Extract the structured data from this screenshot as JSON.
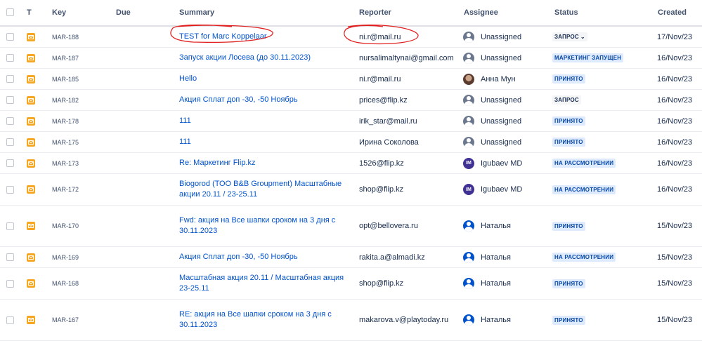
{
  "columns": {
    "t": "T",
    "key": "Key",
    "due": "Due",
    "summary": "Summary",
    "reporter": "Reporter",
    "assignee": "Assignee",
    "status": "Status",
    "created": "Created"
  },
  "colors": {
    "link": "#0052cc",
    "annotation": "#e02020",
    "type_icon": "#f5a623"
  },
  "rows": [
    {
      "key": "MAR-188",
      "summary": "TEST for Marc Koppelaar",
      "reporter": "ni.r@mail.ru",
      "assignee": "Unassigned",
      "assignee_avatar": "generic-user-avatar",
      "status": "ЗАПРОС",
      "status_style": "gray",
      "status_dropdown": true,
      "created": "17/Nov/23"
    },
    {
      "key": "MAR-187",
      "summary": "Запуск акции Лосева (до 30.11.2023)",
      "reporter": "nursalimaltynai@gmail.com",
      "assignee": "Unassigned",
      "assignee_avatar": "generic-user-avatar",
      "status": "МАРКЕТИНГ ЗАПУЩЕН",
      "status_style": "blue",
      "created": "16/Nov/23"
    },
    {
      "key": "MAR-185",
      "summary": "Hello",
      "reporter": "ni.r@mail.ru",
      "assignee": "Анна Мун",
      "assignee_avatar": "photo-avatar",
      "status": "ПРИНЯТО",
      "status_style": "blue",
      "created": "16/Nov/23"
    },
    {
      "key": "MAR-182",
      "summary": "Акция Сплат доп -30, -50 Ноябрь",
      "reporter": "prices@flip.kz",
      "assignee": "Unassigned",
      "assignee_avatar": "generic-user-avatar",
      "status": "ЗАПРОС",
      "status_style": "gray",
      "created": "16/Nov/23"
    },
    {
      "key": "MAR-178",
      "summary": "111",
      "reporter": "irik_star@mail.ru",
      "assignee": "Unassigned",
      "assignee_avatar": "generic-user-avatar",
      "status": "ПРИНЯТО",
      "status_style": "blue",
      "created": "16/Nov/23"
    },
    {
      "key": "MAR-175",
      "summary": "111",
      "reporter": "Ирина Соколова",
      "assignee": "Unassigned",
      "assignee_avatar": "generic-user-avatar",
      "status": "ПРИНЯТО",
      "status_style": "blue",
      "created": "16/Nov/23"
    },
    {
      "key": "MAR-173",
      "summary": "Re: Маркетинг Flip.kz",
      "reporter": "1526@flip.kz",
      "assignee": "Igubaev MD",
      "assignee_avatar": "initials-avatar",
      "avatar_initials": "IM",
      "status": "НА РАССМОТРЕНИИ",
      "status_style": "blue",
      "created": "16/Nov/23"
    },
    {
      "key": "MAR-172",
      "summary": "Biogorod (ТОО B&B Groupment) Масштабные акции 20.11 / 23-25.11",
      "reporter": "shop@flip.kz",
      "assignee": "Igubaev MD",
      "assignee_avatar": "initials-avatar",
      "avatar_initials": "IM",
      "status": "НА РАССМОТРЕНИИ",
      "status_style": "blue",
      "created": "16/Nov/23"
    },
    {
      "key": "MAR-170",
      "summary": "Fwd: акция на Все шапки сроком на 3 дня с 30.11.2023",
      "reporter": "opt@bellovera.ru",
      "assignee": "Наталья",
      "assignee_avatar": "user-avatar",
      "status": "ПРИНЯТО",
      "status_style": "blue",
      "created": "15/Nov/23"
    },
    {
      "key": "MAR-169",
      "summary": "Акция Сплат доп -30, -50 Ноябрь",
      "reporter": "rakita.a@almadi.kz",
      "assignee": "Наталья",
      "assignee_avatar": "user-avatar",
      "status": "НА РАССМОТРЕНИИ",
      "status_style": "blue",
      "created": "15/Nov/23"
    },
    {
      "key": "MAR-168",
      "summary": "Масштабная акция 20.11 / Масштабная акция 23-25.11",
      "reporter": "shop@flip.kz",
      "assignee": "Наталья",
      "assignee_avatar": "user-avatar",
      "status": "ПРИНЯТО",
      "status_style": "blue",
      "created": "15/Nov/23"
    },
    {
      "key": "MAR-167",
      "summary": "RE: акция на Все шапки сроком на 3 дня с 30.11.2023",
      "reporter": "makarova.v@playtoday.ru",
      "assignee": "Наталья",
      "assignee_avatar": "user-avatar",
      "status": "ПРИНЯТО",
      "status_style": "blue",
      "created": "15/Nov/23"
    }
  ]
}
